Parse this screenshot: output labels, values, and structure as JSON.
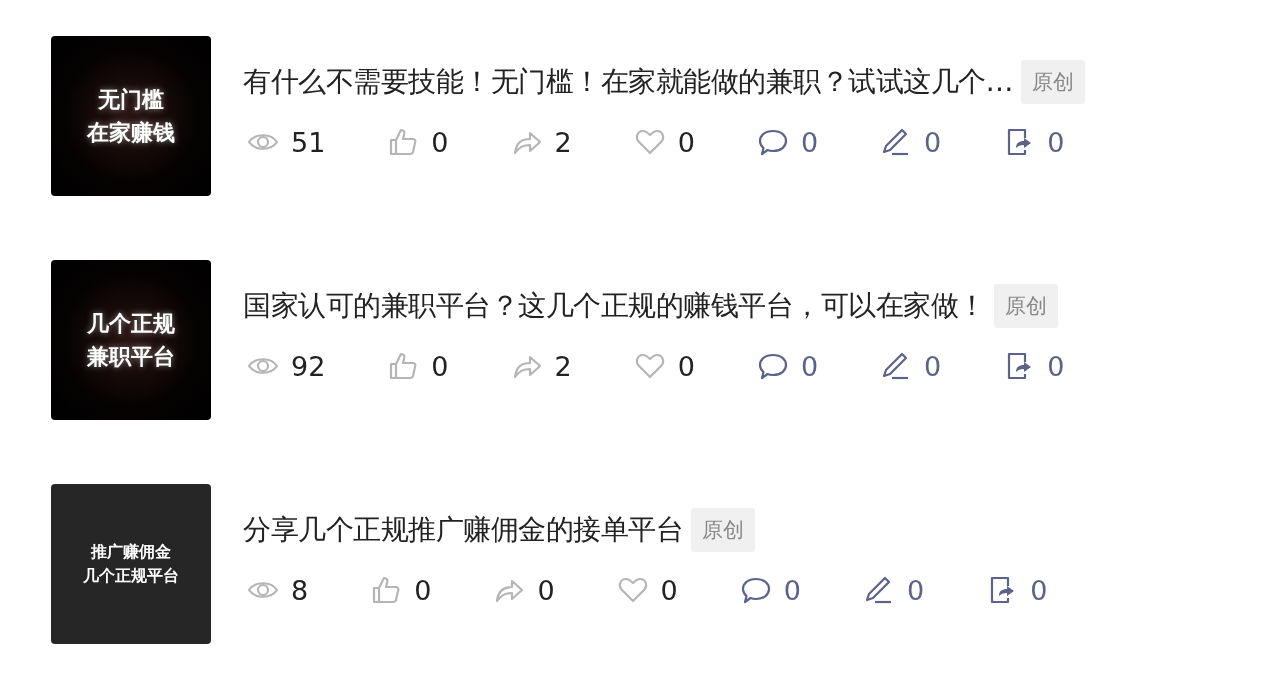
{
  "articles": [
    {
      "cover": {
        "lines": [
          "无门槛",
          "在家赚钱"
        ],
        "kind": "glow"
      },
      "title": "有什么不需要技能！无门槛！在家就能做的兼职？试试这几个…",
      "badge": "原创",
      "stats": [
        {
          "kind": "views",
          "value": "51"
        },
        {
          "kind": "likes",
          "value": "0"
        },
        {
          "kind": "shares",
          "value": "2"
        },
        {
          "kind": "favorites",
          "value": "0"
        },
        {
          "kind": "comments",
          "value": "0"
        },
        {
          "kind": "edits",
          "value": "0"
        },
        {
          "kind": "exports",
          "value": "0"
        }
      ]
    },
    {
      "cover": {
        "lines": [
          "几个正规",
          "兼职平台"
        ],
        "kind": "glow"
      },
      "title": "国家认可的兼职平台？这几个正规的赚钱平台，可以在家做！",
      "badge": "原创",
      "stats": [
        {
          "kind": "views",
          "value": "92"
        },
        {
          "kind": "likes",
          "value": "0"
        },
        {
          "kind": "shares",
          "value": "2"
        },
        {
          "kind": "favorites",
          "value": "0"
        },
        {
          "kind": "comments",
          "value": "0"
        },
        {
          "kind": "edits",
          "value": "0"
        },
        {
          "kind": "exports",
          "value": "0"
        }
      ]
    },
    {
      "cover": {
        "lines": [
          "推广赚佣金",
          "几个正规平台"
        ],
        "kind": "plain"
      },
      "title": "分享几个正规推广赚佣金的接单平台",
      "badge": "原创",
      "stats": [
        {
          "kind": "views",
          "value": "8"
        },
        {
          "kind": "likes",
          "value": "0"
        },
        {
          "kind": "shares",
          "value": "0"
        },
        {
          "kind": "favorites",
          "value": "0"
        },
        {
          "kind": "comments",
          "value": "0"
        },
        {
          "kind": "edits",
          "value": "0"
        },
        {
          "kind": "exports",
          "value": "0"
        }
      ]
    }
  ]
}
